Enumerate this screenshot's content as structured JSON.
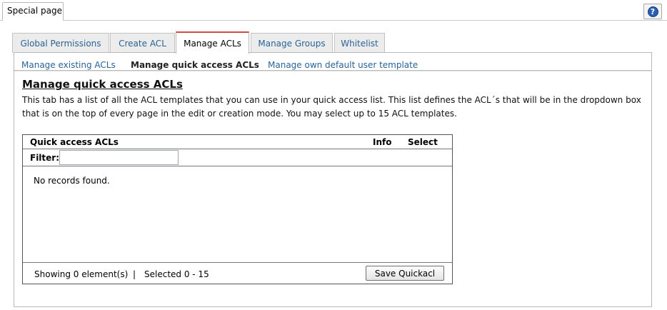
{
  "page_tab": {
    "label": "Special page"
  },
  "help": {
    "label": "?"
  },
  "tabs": [
    {
      "label": "Global Permissions",
      "active": false
    },
    {
      "label": "Create ACL",
      "active": false
    },
    {
      "label": "Manage ACLs",
      "active": true
    },
    {
      "label": "Manage Groups",
      "active": false
    },
    {
      "label": "Whitelist",
      "active": false
    }
  ],
  "subnav": {
    "items": [
      {
        "label": "Manage existing ACLs",
        "current": false
      },
      {
        "label": "Manage quick access ACLs",
        "current": true
      },
      {
        "label": "Manage own default user template",
        "current": false
      }
    ]
  },
  "section": {
    "title": "Manage quick access ACLs",
    "description": "This tab has a list of all the ACL templates that you can use in your quick access list. This list defines the ACL´s that will be in the dropdown box that is on the top of every page in the edit or creation mode. You may select up to 15 ACL templates."
  },
  "table": {
    "columns": {
      "name": "Quick access ACLs",
      "info": "Info",
      "select": "Select"
    },
    "filter_label": "Filter:",
    "filter_value": "",
    "empty_message": "No records found.",
    "footer": {
      "showing": "Showing 0 element(s)",
      "separator": "|",
      "selected": "Selected 0 - 15",
      "save_button": "Save Quickacl"
    }
  },
  "colors": {
    "accent_tab_border": "#d24b43",
    "link": "#2a6496",
    "help_icon": "#2a5fb0"
  }
}
